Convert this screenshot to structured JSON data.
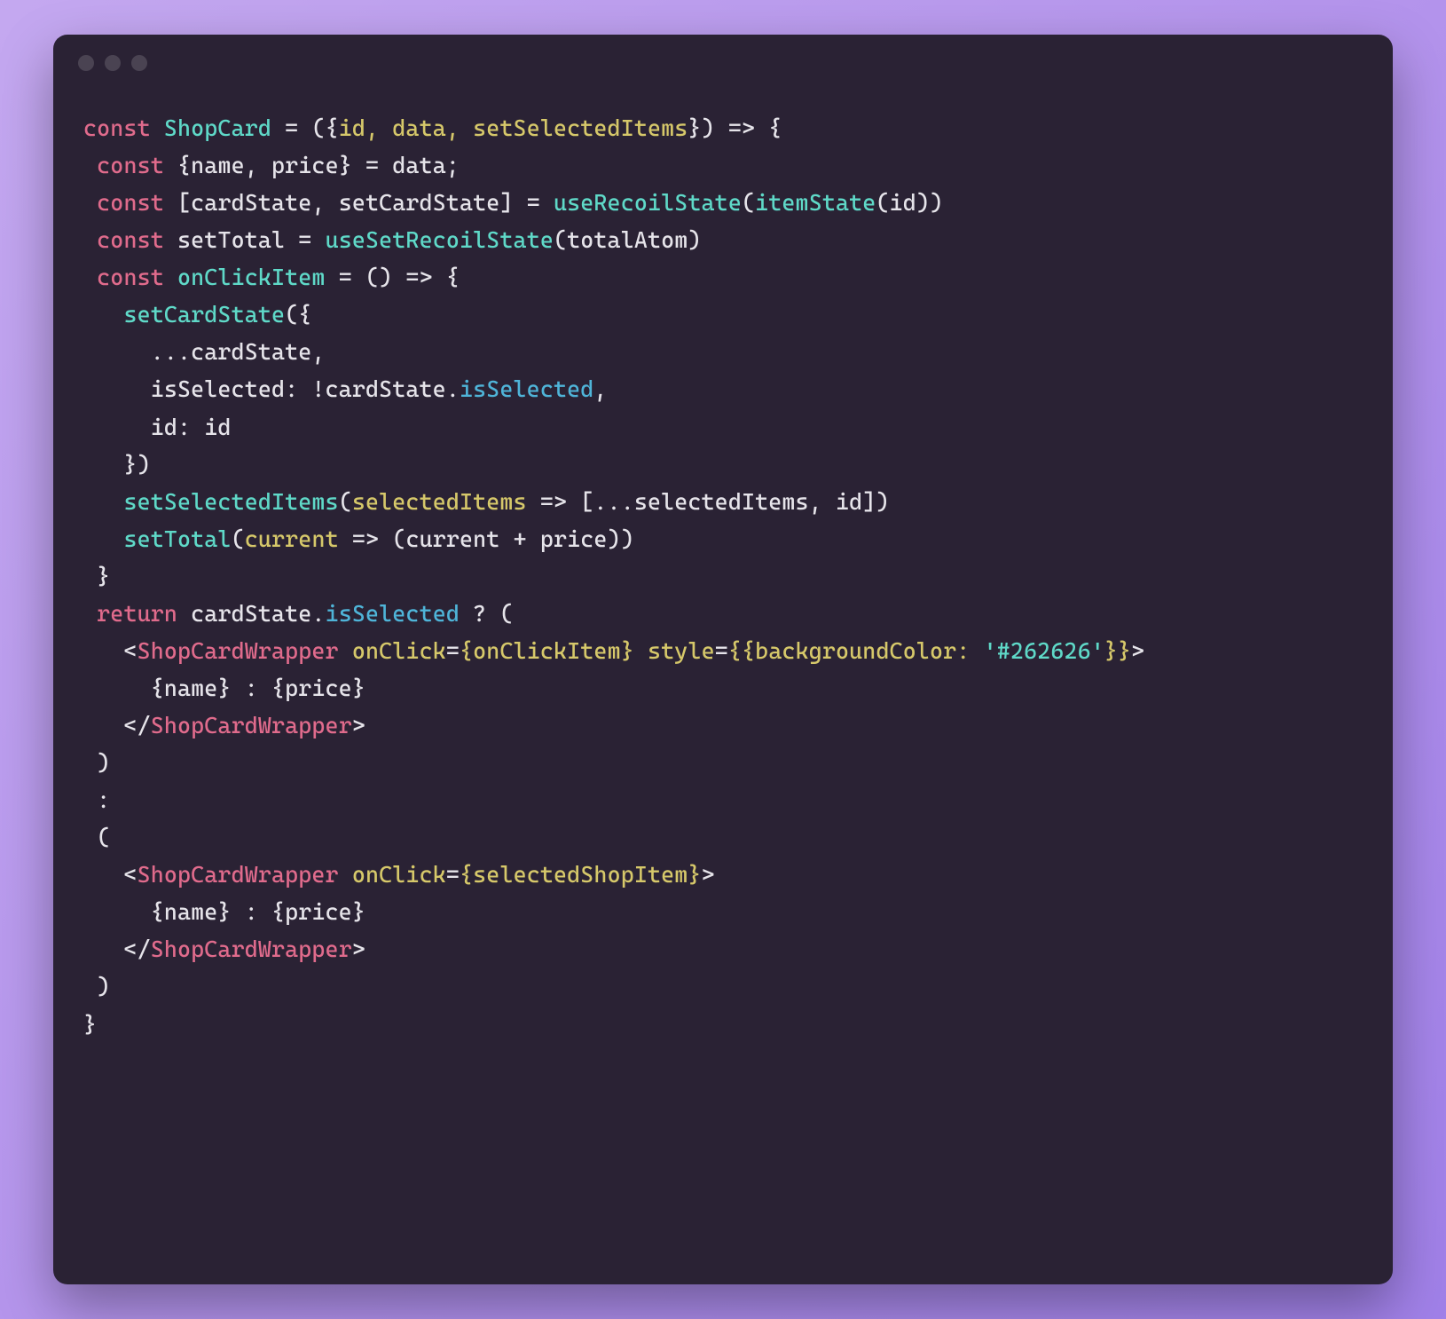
{
  "window": {
    "traffic_light_color": "#4a4352"
  },
  "code": {
    "tokens": [
      [
        {
          "t": "const ",
          "c": "kw"
        },
        {
          "t": "ShopCard",
          "c": "fn"
        },
        {
          "t": " = ({",
          "c": "punc"
        },
        {
          "t": "id, data, setSelectedItems",
          "c": "param"
        },
        {
          "t": "}) => {",
          "c": "punc"
        }
      ],
      [
        {
          "t": " ",
          "c": "punc"
        },
        {
          "t": "const ",
          "c": "kw"
        },
        {
          "t": "{name, price} = data;",
          "c": "punc"
        }
      ],
      [
        {
          "t": " ",
          "c": "punc"
        },
        {
          "t": "const ",
          "c": "kw"
        },
        {
          "t": "[cardState, setCardState] = ",
          "c": "punc"
        },
        {
          "t": "useRecoilState",
          "c": "call"
        },
        {
          "t": "(",
          "c": "punc"
        },
        {
          "t": "itemState",
          "c": "call"
        },
        {
          "t": "(id))",
          "c": "punc"
        }
      ],
      [
        {
          "t": " ",
          "c": "punc"
        },
        {
          "t": "const ",
          "c": "kw"
        },
        {
          "t": "setTotal = ",
          "c": "punc"
        },
        {
          "t": "useSetRecoilState",
          "c": "call"
        },
        {
          "t": "(totalAtom)",
          "c": "punc"
        }
      ],
      [
        {
          "t": " ",
          "c": "punc"
        },
        {
          "t": "const ",
          "c": "kw"
        },
        {
          "t": "onClickItem",
          "c": "call"
        },
        {
          "t": " = () => {",
          "c": "punc"
        }
      ],
      [
        {
          "t": "   ",
          "c": "punc"
        },
        {
          "t": "setCardState",
          "c": "call"
        },
        {
          "t": "({",
          "c": "punc"
        }
      ],
      [
        {
          "t": "     ...cardState,",
          "c": "punc"
        }
      ],
      [
        {
          "t": "     isSelected: !cardState.",
          "c": "punc"
        },
        {
          "t": "isSelected",
          "c": "prop"
        },
        {
          "t": ",",
          "c": "punc"
        }
      ],
      [
        {
          "t": "     id: id",
          "c": "punc"
        }
      ],
      [
        {
          "t": "   })",
          "c": "punc"
        }
      ],
      [
        {
          "t": "   ",
          "c": "punc"
        },
        {
          "t": "setSelectedItems",
          "c": "call"
        },
        {
          "t": "(",
          "c": "punc"
        },
        {
          "t": "selectedItems",
          "c": "param"
        },
        {
          "t": " => [...selectedItems, id])",
          "c": "punc"
        }
      ],
      [
        {
          "t": "   ",
          "c": "punc"
        },
        {
          "t": "setTotal",
          "c": "call"
        },
        {
          "t": "(",
          "c": "punc"
        },
        {
          "t": "current",
          "c": "param"
        },
        {
          "t": " => (current + price))",
          "c": "punc"
        }
      ],
      [
        {
          "t": " }",
          "c": "punc"
        }
      ],
      [
        {
          "t": " ",
          "c": "punc"
        },
        {
          "t": "return ",
          "c": "kw"
        },
        {
          "t": "cardState.",
          "c": "punc"
        },
        {
          "t": "isSelected",
          "c": "prop"
        },
        {
          "t": " ? (",
          "c": "punc"
        }
      ],
      [
        {
          "t": "   <",
          "c": "punc"
        },
        {
          "t": "ShopCardWrapper",
          "c": "tag"
        },
        {
          "t": " ",
          "c": "punc"
        },
        {
          "t": "onClick",
          "c": "attr"
        },
        {
          "t": "=",
          "c": "punc"
        },
        {
          "t": "{onClickItem}",
          "c": "param"
        },
        {
          "t": " ",
          "c": "punc"
        },
        {
          "t": "style",
          "c": "attr"
        },
        {
          "t": "=",
          "c": "punc"
        },
        {
          "t": "{{backgroundColor: ",
          "c": "param"
        },
        {
          "t": "'#262626'",
          "c": "str"
        },
        {
          "t": "}}",
          "c": "param"
        },
        {
          "t": ">",
          "c": "punc"
        }
      ],
      [
        {
          "t": "     {name} : {price}",
          "c": "punc"
        }
      ],
      [
        {
          "t": "   </",
          "c": "punc"
        },
        {
          "t": "ShopCardWrapper",
          "c": "tag"
        },
        {
          "t": ">",
          "c": "punc"
        }
      ],
      [
        {
          "t": " )",
          "c": "punc"
        }
      ],
      [
        {
          "t": " :",
          "c": "punc"
        }
      ],
      [
        {
          "t": " (",
          "c": "punc"
        }
      ],
      [
        {
          "t": "   <",
          "c": "punc"
        },
        {
          "t": "ShopCardWrapper",
          "c": "tag"
        },
        {
          "t": " ",
          "c": "punc"
        },
        {
          "t": "onClick",
          "c": "attr"
        },
        {
          "t": "=",
          "c": "punc"
        },
        {
          "t": "{selectedShopItem}",
          "c": "param"
        },
        {
          "t": ">",
          "c": "punc"
        }
      ],
      [
        {
          "t": "     {name} : {price}",
          "c": "punc"
        }
      ],
      [
        {
          "t": "   </",
          "c": "punc"
        },
        {
          "t": "ShopCardWrapper",
          "c": "tag"
        },
        {
          "t": ">",
          "c": "punc"
        }
      ],
      [
        {
          "t": " )",
          "c": "punc"
        }
      ],
      [
        {
          "t": "}",
          "c": "punc"
        }
      ]
    ]
  }
}
